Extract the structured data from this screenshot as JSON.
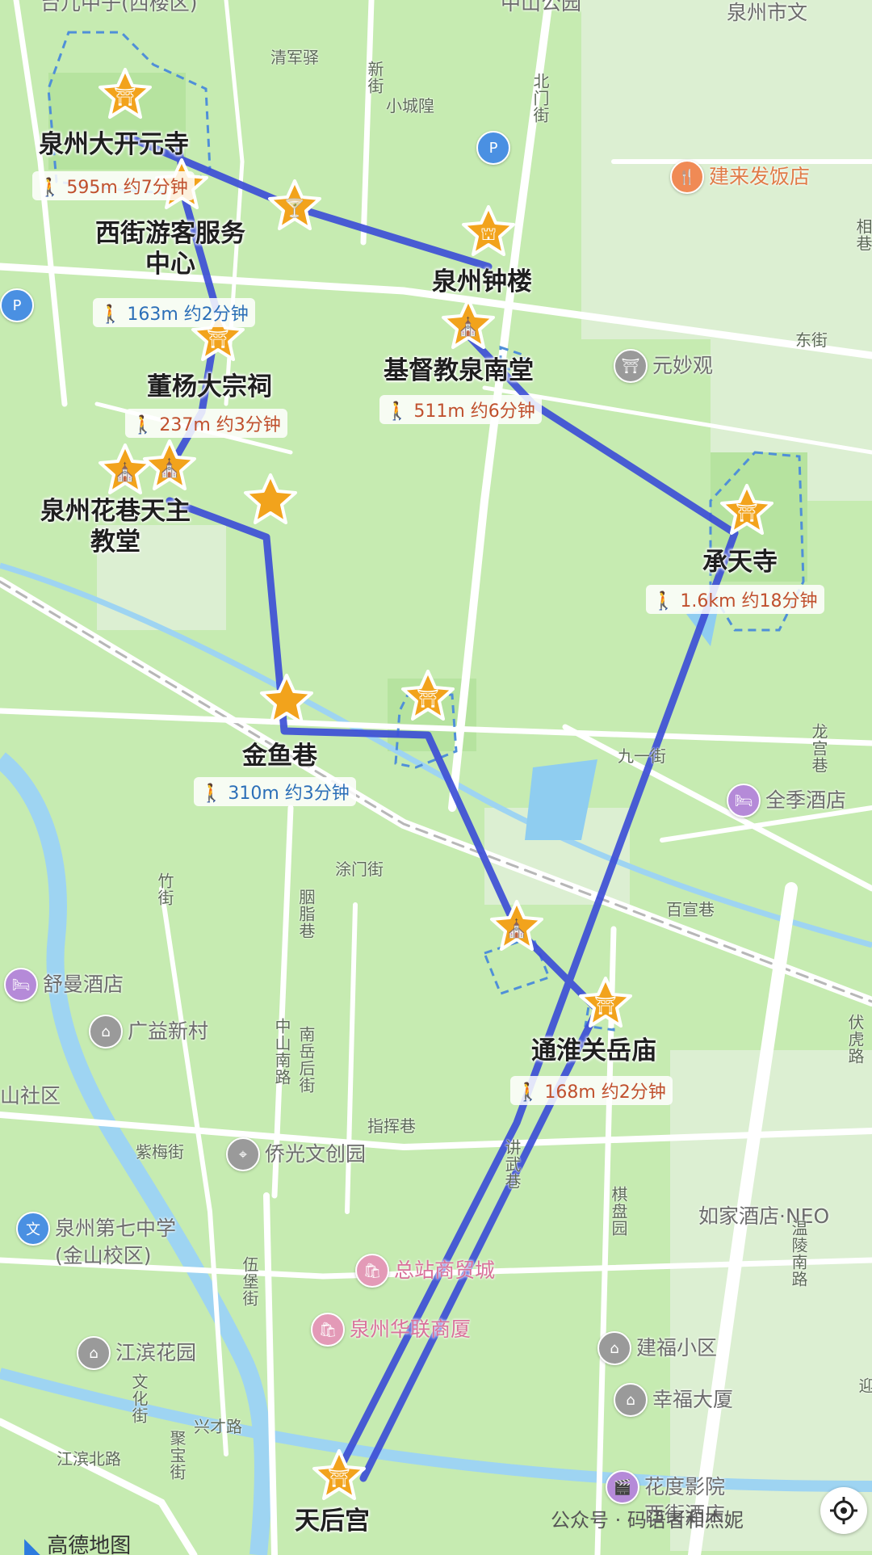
{
  "map": {
    "brand": "高德地图",
    "watermark": "公众号 · 码语者和杰妮",
    "top_cut_labels": [
      "台儿中子(西楼区)",
      "中山公园",
      "泉州市文"
    ]
  },
  "stops": [
    {
      "name": "泉州大开元寺",
      "icon": "pagoda"
    },
    {
      "name": "西街游客服务\n中心",
      "icon": "star"
    },
    {
      "name": "泉州钟楼",
      "icon": "gate"
    },
    {
      "name": "基督教泉南堂",
      "icon": "church"
    },
    {
      "name": "董杨大宗祠",
      "icon": "pagoda"
    },
    {
      "name": "泉州花巷天主\n教堂",
      "icon": "church"
    },
    {
      "name": "承天寺",
      "icon": "pagoda"
    },
    {
      "name": "金鱼巷",
      "icon": "star"
    },
    {
      "name": "通淮关岳庙",
      "icon": "pagoda"
    },
    {
      "name": "天后宫",
      "icon": "pagoda"
    }
  ],
  "walks": [
    {
      "text": "595m 约7分钟"
    },
    {
      "text": "163m 约2分钟"
    },
    {
      "text": "237m 约3分钟"
    },
    {
      "text": "511m 约6分钟"
    },
    {
      "text": "1.6km 约18分钟"
    },
    {
      "text": "310m 约3分钟"
    },
    {
      "text": "168m 约2分钟"
    }
  ],
  "pois": [
    {
      "name": "建来发饭店",
      "icon": "fork-icon"
    },
    {
      "name": "元妙观",
      "icon": "temple-icon"
    },
    {
      "name": "全季酒店",
      "icon": "bed-icon"
    },
    {
      "name": "舒曼酒店",
      "icon": "bed-icon"
    },
    {
      "name": "广益新村",
      "icon": "house-icon"
    },
    {
      "name": "侨光文创园",
      "icon": "pin-icon"
    },
    {
      "name": "泉州第七中学\n(金山校区)",
      "icon": "school-icon"
    },
    {
      "name": "总站商贸城",
      "icon": "shop-icon"
    },
    {
      "name": "泉州华联商厦",
      "icon": "shop-icon"
    },
    {
      "name": "如家酒店·NEO",
      "icon": "bed-icon"
    },
    {
      "name": "建福小区",
      "icon": "house-icon"
    },
    {
      "name": "幸福大厦",
      "icon": "house-icon"
    },
    {
      "name": "江滨花园",
      "icon": "house-icon"
    },
    {
      "name": "花度影院\n西街酒店",
      "icon": "film-icon"
    },
    {
      "name": "山社区",
      "icon": "house-icon"
    }
  ],
  "streets": [
    "清军驿",
    "新街",
    "小城隍",
    "北门街",
    "东街",
    "相巷",
    "九一街",
    "龙宫巷",
    "涂门街",
    "百宣巷",
    "竹街",
    "胭脂巷",
    "南岳后街",
    "中山南路",
    "指挥巷",
    "讲武巷",
    "紫梅街",
    "伍堡街",
    "兴才路",
    "文化街",
    "聚宝街",
    "江滨北路",
    "温陵南路",
    "棋盘园",
    "伏虎路",
    "迎"
  ]
}
